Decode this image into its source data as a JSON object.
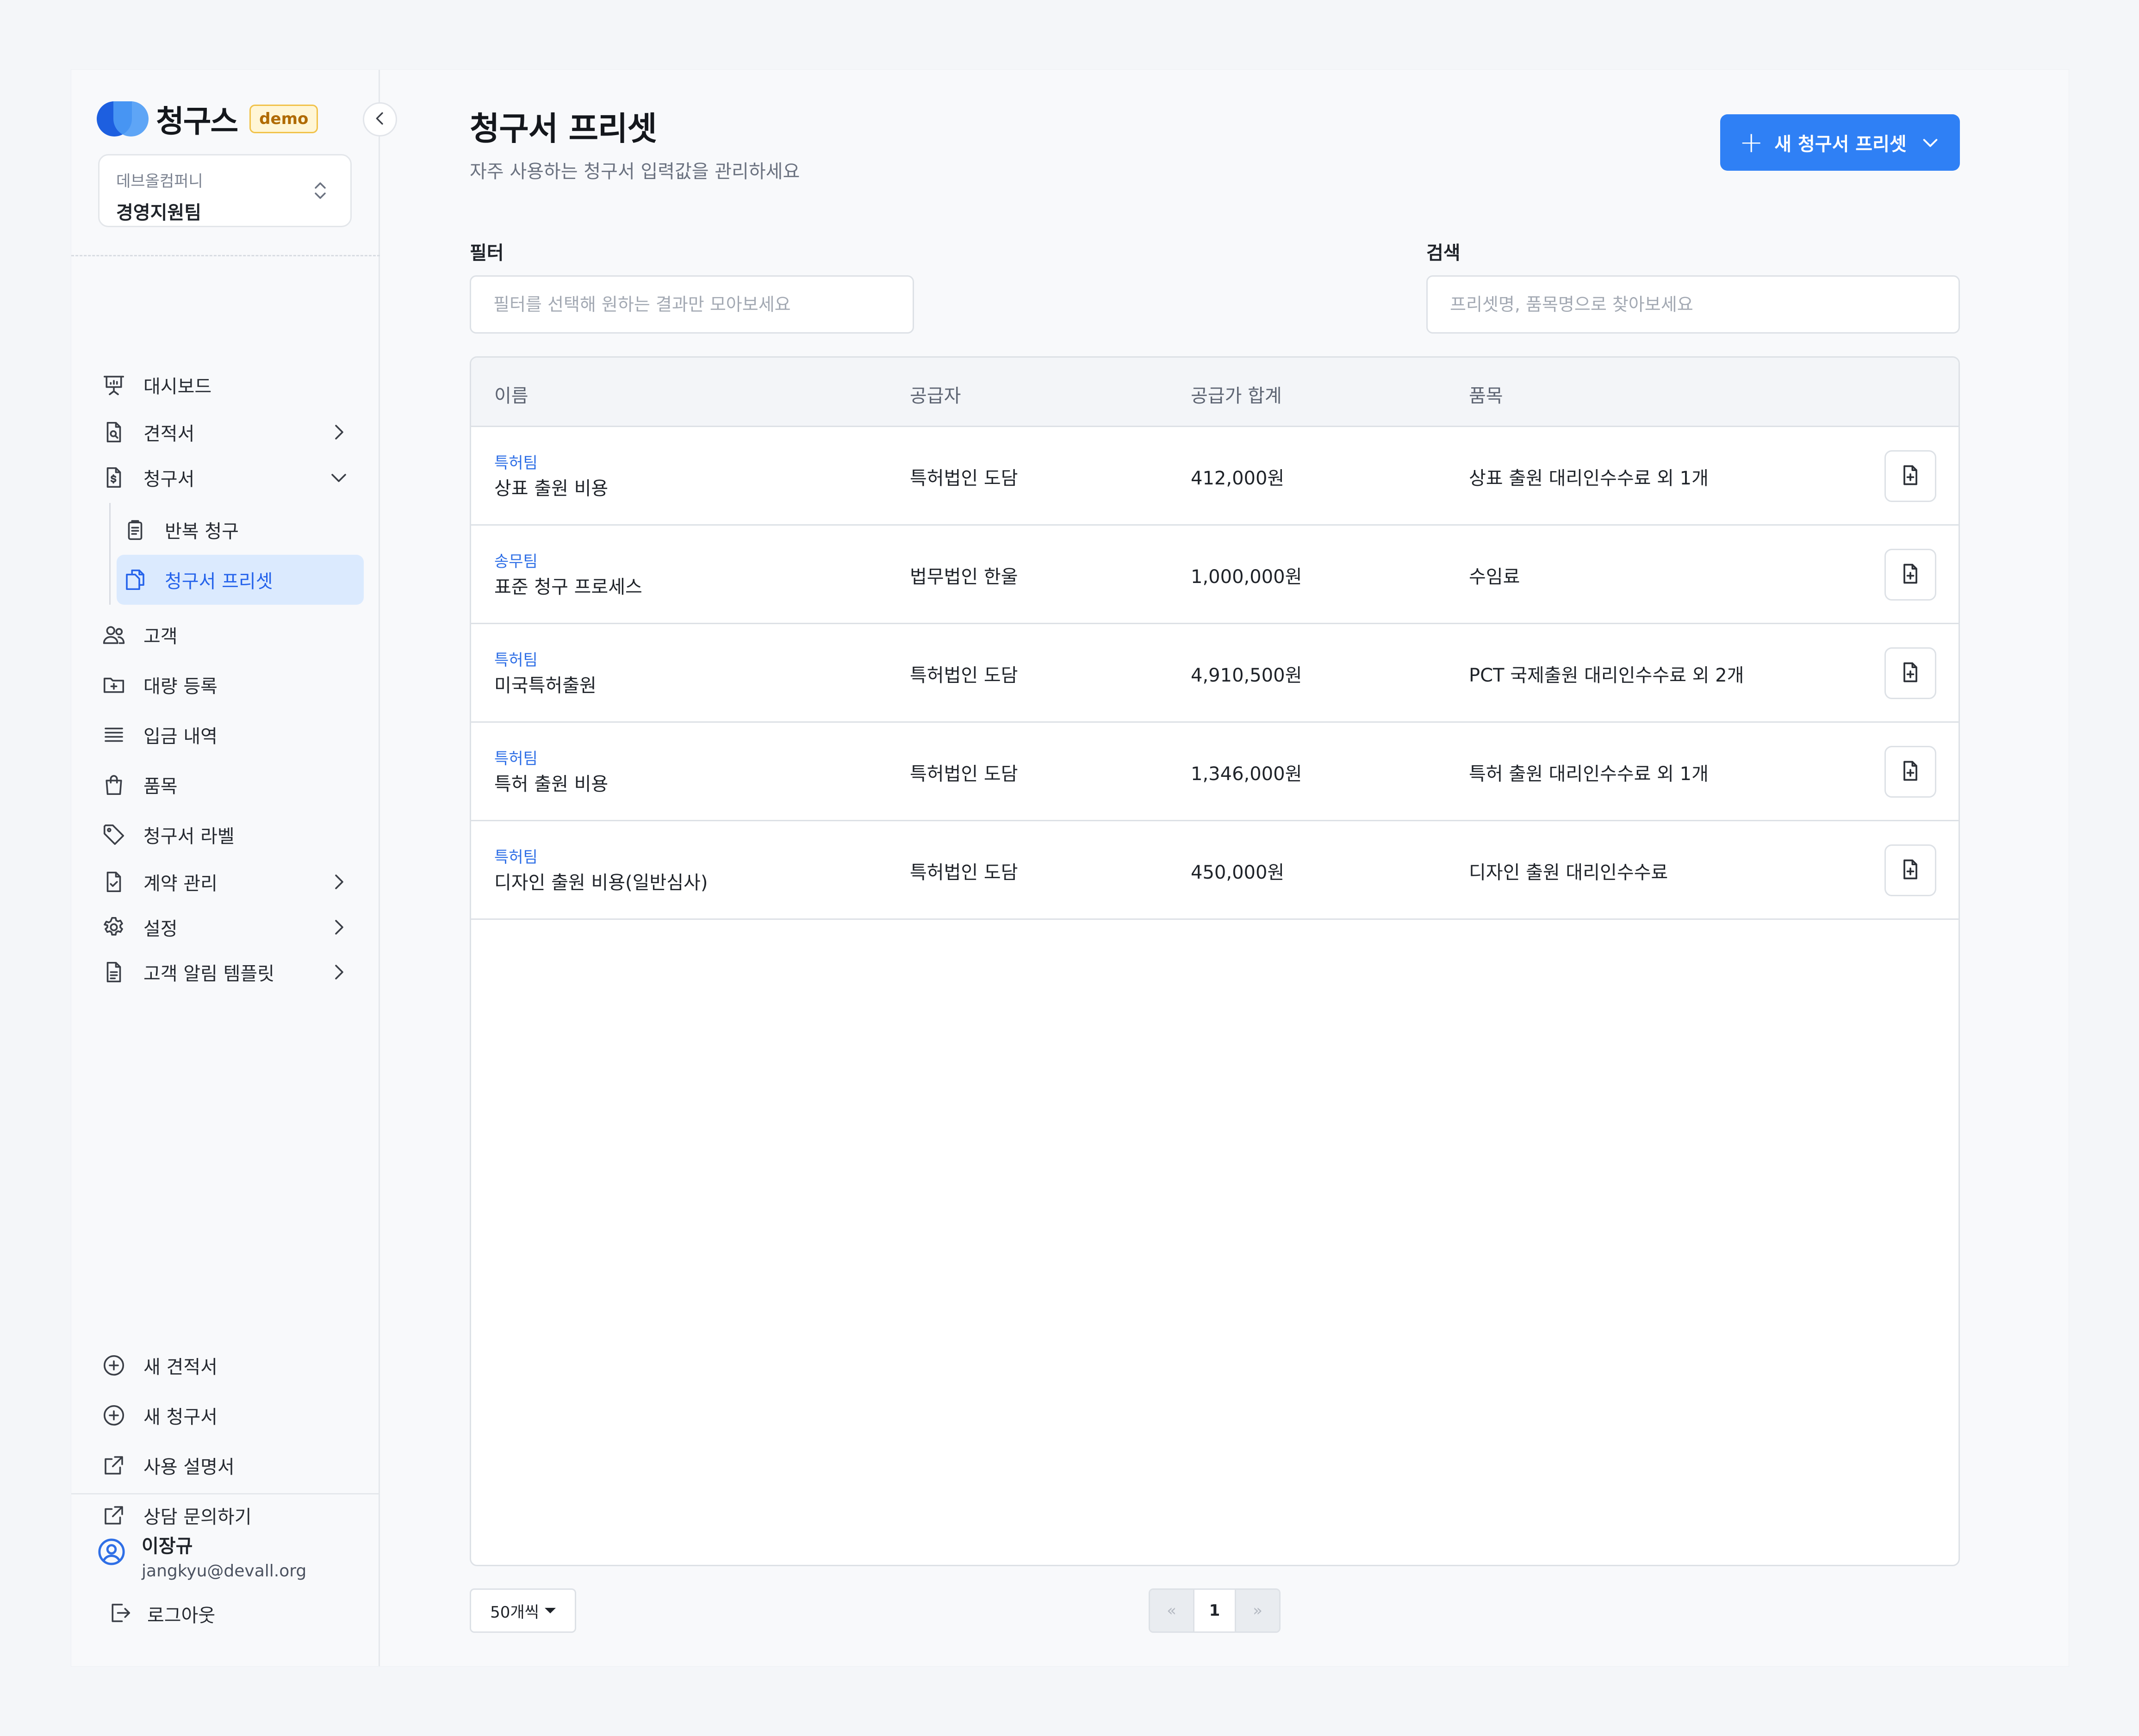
{
  "brand": {
    "name": "청구스",
    "badge": "demo"
  },
  "org": {
    "company": "데브올컴퍼니",
    "team": "경영지원팀"
  },
  "nav": {
    "dashboard": "대시보드",
    "quotes": "견적서",
    "invoices": "청구서",
    "recurring": "반복 청구",
    "presets": "청구서 프리셋",
    "customers": "고객",
    "bulk": "대량 등록",
    "deposits": "입금 내역",
    "items": "품목",
    "labels": "청구서 라벨",
    "contracts": "계약 관리",
    "settings": "설정",
    "templates": "고객 알림 템플릿"
  },
  "shortcuts": {
    "new_quote": "새 견적서",
    "new_invoice": "새 청구서",
    "manual": "사용 설명서",
    "contact": "상담 문의하기"
  },
  "user": {
    "name": "이장규",
    "email": "jangkyu@devall.org",
    "logout": "로그아웃"
  },
  "page": {
    "title": "청구서 프리셋",
    "subtitle": "자주 사용하는 청구서 입력값을 관리하세요",
    "new_button": "새 청구서 프리셋"
  },
  "filter": {
    "label": "필터",
    "placeholder": "필터를 선택해 원하는 결과만 모아보세요"
  },
  "search": {
    "label": "검색",
    "placeholder": "프리셋명, 품목명으로 찾아보세요"
  },
  "table": {
    "headers": {
      "name": "이름",
      "supplier": "공급자",
      "total": "공급가 합계",
      "items": "품목"
    },
    "rows": [
      {
        "tag": "특허팀",
        "name": "상표 출원 비용",
        "supplier": "특허법인 도담",
        "total": "412,000원",
        "items": "상표 출원 대리인수수료 외 1개"
      },
      {
        "tag": "송무팀",
        "name": "표준 청구 프로세스",
        "supplier": "법무법인 한울",
        "total": "1,000,000원",
        "items": "수임료"
      },
      {
        "tag": "특허팀",
        "name": "미국특허출원",
        "supplier": "특허법인 도담",
        "total": "4,910,500원",
        "items": "PCT 국제출원 대리인수수료 외 2개"
      },
      {
        "tag": "특허팀",
        "name": "특허 출원 비용",
        "supplier": "특허법인 도담",
        "total": "1,346,000원",
        "items": "특허 출원 대리인수수료 외 1개"
      },
      {
        "tag": "특허팀",
        "name": "디자인 출원 비용(일반심사)",
        "supplier": "특허법인 도담",
        "total": "450,000원",
        "items": "디자인 출원 대리인수수료"
      }
    ]
  },
  "pagination": {
    "per_page": "50개씩",
    "prev": "«",
    "current": "1",
    "next": "»"
  },
  "colors": {
    "accent": "#2f80f5",
    "tag": "#2f6fe6",
    "active_bg": "#dbeafe"
  }
}
